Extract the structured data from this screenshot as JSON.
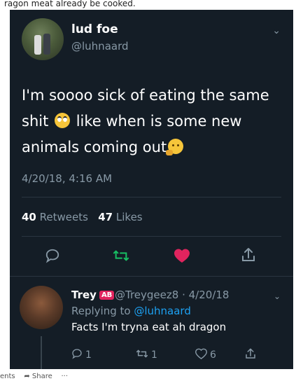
{
  "page": {
    "top_cut_text": "ragon meat already be cooked."
  },
  "tweet": {
    "name": "lud foe",
    "handle": "@luhnaard",
    "text_1": "I'm soooo sick of eating the same shit",
    "text_2": "like when is some new animals coming out",
    "timestamp": "4/20/18, 4:16 AM",
    "retweets_count": "40",
    "retweets_label": "Retweets",
    "likes_count": "47",
    "likes_label": "Likes",
    "colors": {
      "background": "#141d26",
      "retweet": "#17bf63",
      "like": "#e0245e",
      "link": "#1da1f2"
    }
  },
  "reply": {
    "name": "Trey",
    "badge": "AB",
    "meta": "@Treygeez8 · 4/20/18",
    "replying_prefix": "Replying to",
    "replying_handle": "@luhnaard",
    "text": "Facts I'm tryna eat ah dragon",
    "reply_count": "1",
    "retweet_count": "1",
    "like_count": "6"
  },
  "footer": {
    "comments": "ents",
    "share": "Share",
    "more": "···"
  }
}
